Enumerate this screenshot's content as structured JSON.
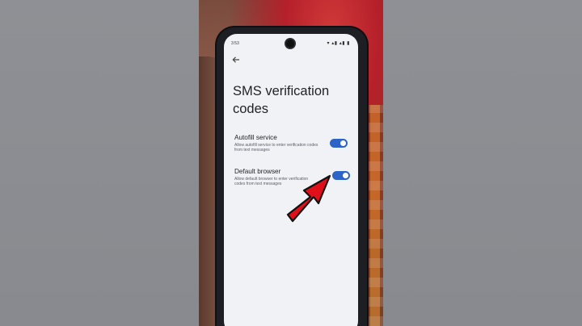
{
  "status_bar": {
    "time": "3:53",
    "icons": "▾ ▴▮ ▴▮ ▮"
  },
  "nav": {
    "back_icon": "arrow-back"
  },
  "page": {
    "title": "SMS verification codes"
  },
  "settings": [
    {
      "title": "Autofill service",
      "description": "Allow autofill service to enter verification codes from text messages",
      "enabled": true
    },
    {
      "title": "Default browser",
      "description": "Allow default browser to enter verification codes from text messages",
      "enabled": true
    }
  ],
  "colors": {
    "toggle_on": "#2b63c6",
    "screen_bg": "#f1f2f6",
    "annotation_arrow": "#e0101a"
  }
}
